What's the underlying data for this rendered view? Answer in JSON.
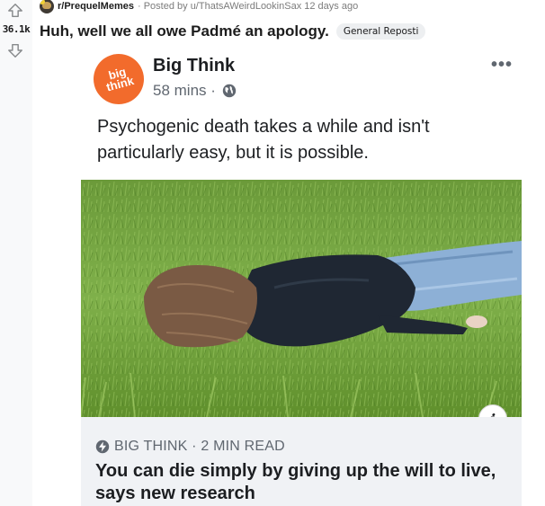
{
  "vote": {
    "count": "36.1k",
    "upvote_icon": "arrow-up-icon",
    "downvote_icon": "arrow-down-icon"
  },
  "post": {
    "subreddit": "r/PrequelMemes",
    "posted_by_prefix": "· Posted by",
    "author": "u/ThatsAWeirdLookinSax",
    "age": "12 days ago",
    "title": "Huh, well we all owe Padmé an apology.",
    "flair": "General Reposti"
  },
  "embedded_post": {
    "page_name": "Big Think",
    "logo_text": [
      "big",
      "think"
    ],
    "time": "58 mins",
    "separator": "·",
    "privacy_icon": "globe-icon",
    "more_icon": "more-options-icon",
    "more_label": "•••",
    "text": "Psychogenic death takes a while and isn't particularly easy, but it is possible.",
    "info_label": "i",
    "link": {
      "source": "BIG THINK · 2 MIN READ",
      "title": "You can die simply by giving up the will to live, says new research"
    }
  },
  "colors": {
    "brand_orange": "#f26b2c",
    "link_box_bg": "#f0f2f5",
    "flair_bg": "#edeff1",
    "vote_bg": "#f8f9fa"
  }
}
